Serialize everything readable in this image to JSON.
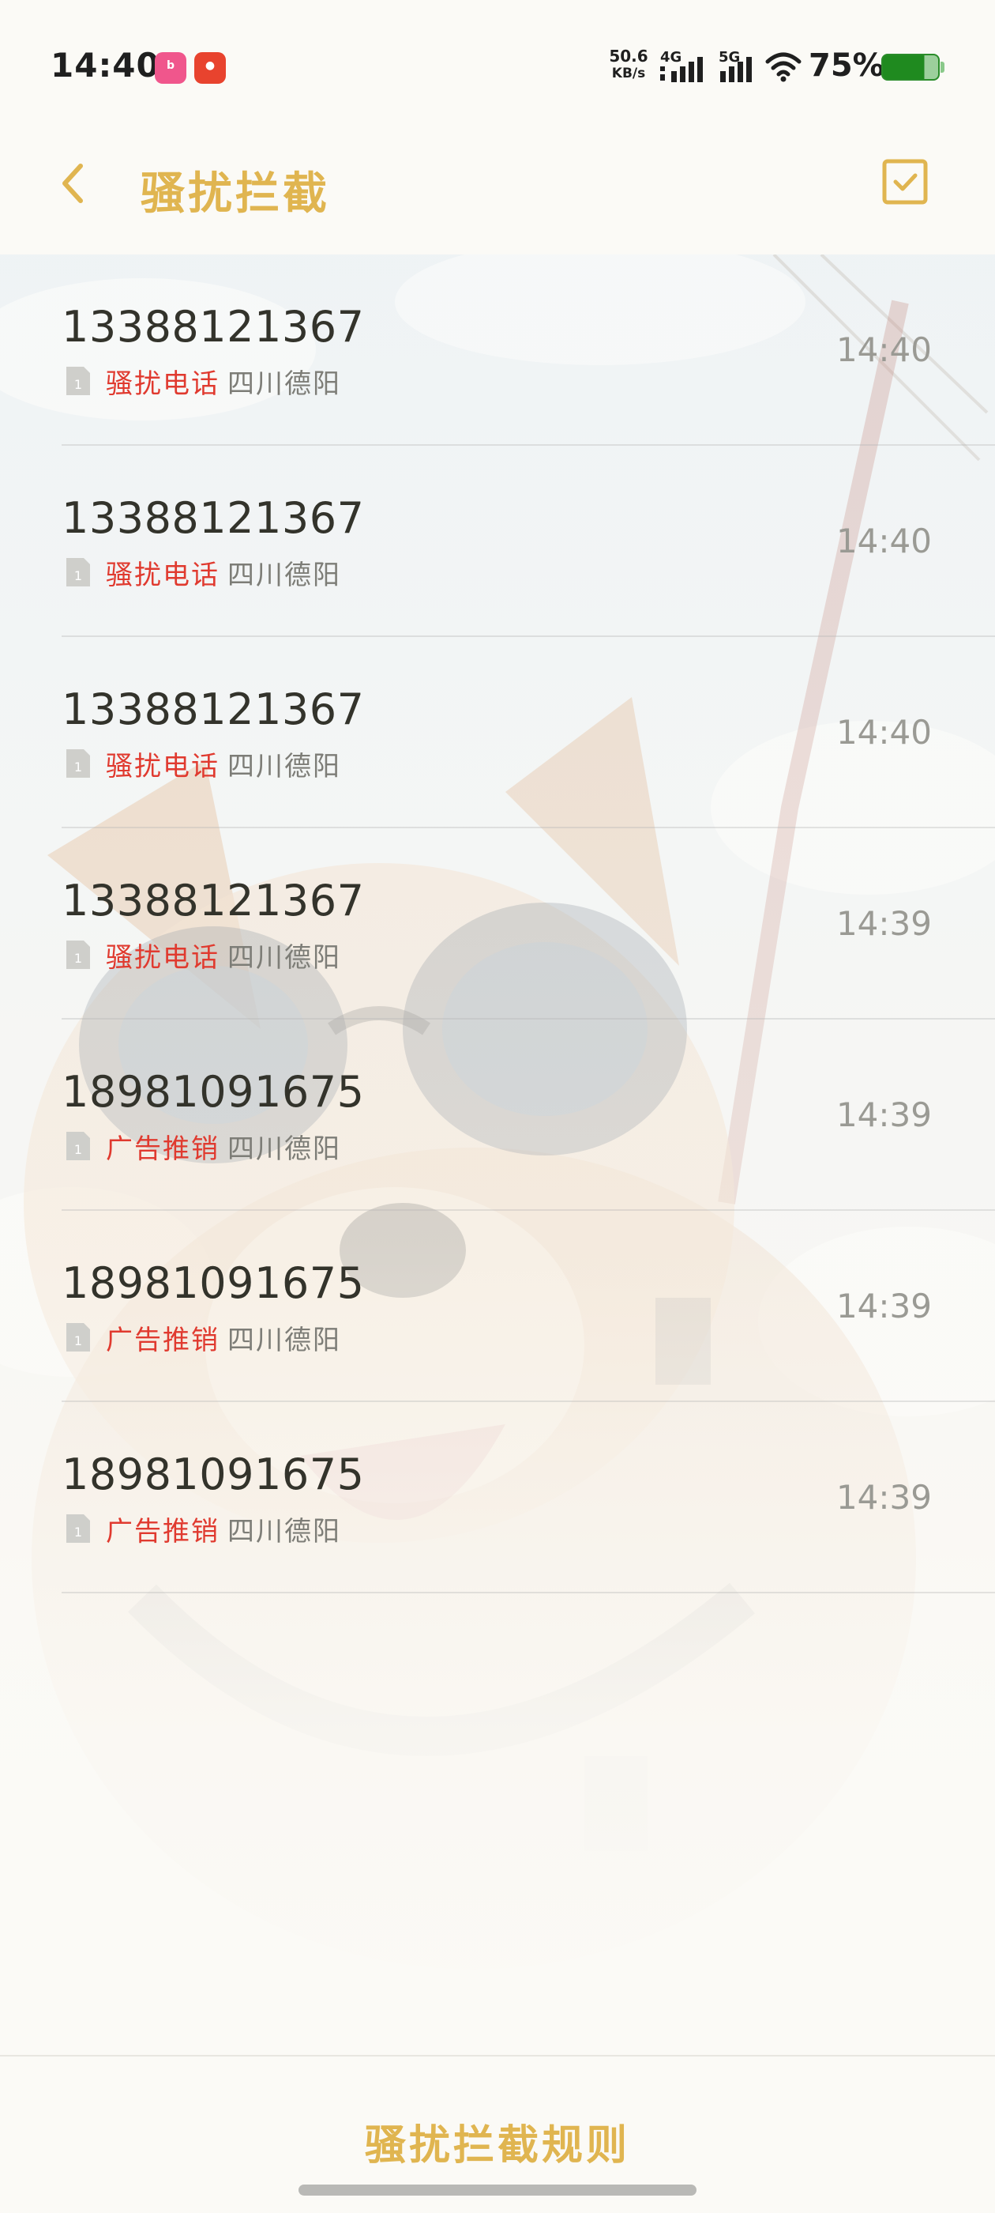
{
  "status_bar": {
    "time": "14:40",
    "net_speed_value": "50.6",
    "net_speed_unit": "KB/s",
    "sim1_label": "4G",
    "sim2_label": "5G",
    "battery_percent": "75%",
    "battery_level": 0.75,
    "notification_icons": [
      "bilibili-app-icon",
      "red-app-icon"
    ]
  },
  "header": {
    "title": "骚扰拦截",
    "back_icon": "chevron-left-icon",
    "select_icon": "checkbox-icon",
    "accent_color": "#e0b550"
  },
  "calls": [
    {
      "number": "13388121367",
      "sim": "1",
      "tag": "骚扰电话",
      "location": "四川德阳",
      "time": "14:40"
    },
    {
      "number": "13388121367",
      "sim": "1",
      "tag": "骚扰电话",
      "location": "四川德阳",
      "time": "14:40"
    },
    {
      "number": "13388121367",
      "sim": "1",
      "tag": "骚扰电话",
      "location": "四川德阳",
      "time": "14:40"
    },
    {
      "number": "13388121367",
      "sim": "1",
      "tag": "骚扰电话",
      "location": "四川德阳",
      "time": "14:39"
    },
    {
      "number": "18981091675",
      "sim": "1",
      "tag": "广告推销",
      "location": "四川德阳",
      "time": "14:39"
    },
    {
      "number": "18981091675",
      "sim": "1",
      "tag": "广告推销",
      "location": "四川德阳",
      "time": "14:39"
    },
    {
      "number": "18981091675",
      "sim": "1",
      "tag": "广告推销",
      "location": "四川德阳",
      "time": "14:39"
    }
  ],
  "bottom": {
    "rules_label": "骚扰拦截规则"
  },
  "colors": {
    "tag_red": "#e03a2f",
    "number_text": "#33332b",
    "muted_text": "#9a9a94",
    "battery_green": "#1f8a1f"
  }
}
